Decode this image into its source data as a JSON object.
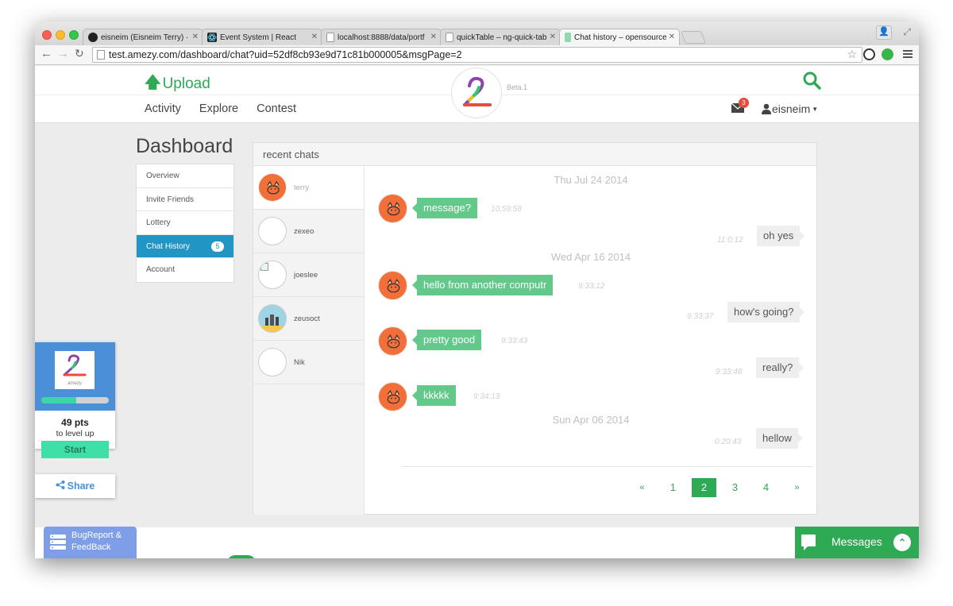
{
  "browser": {
    "tabs": [
      {
        "title": "eisneim (Eisneim Terry) · G",
        "icon": "github-icon"
      },
      {
        "title": "Event System | React",
        "icon": "react-icon"
      },
      {
        "title": "localhost:8888/data/portf",
        "icon": "page-icon"
      },
      {
        "title": "quickTable – ng-quick-tab",
        "icon": "page-icon"
      },
      {
        "title": "Chat history – opensource",
        "icon": "page-icon"
      }
    ],
    "url": "test.amezy.com/dashboard/chat?uid=52df8cb93e9d71c81b000005&msgPage=2"
  },
  "header": {
    "upload_label": "Upload",
    "beta_label": "Beta.1",
    "nav": [
      "Activity",
      "Explore",
      "Contest"
    ],
    "unread_count": "3",
    "username": "eisneim"
  },
  "dashboard": {
    "title": "Dashboard",
    "menu": [
      {
        "label": "Overview"
      },
      {
        "label": "Invite Friends"
      },
      {
        "label": "Lottery"
      },
      {
        "label": "Chat History",
        "badge": "5"
      },
      {
        "label": "Account"
      }
    ]
  },
  "chat": {
    "panel_title": "recent chats",
    "contacts": [
      {
        "name": "terry"
      },
      {
        "name": "zexeo"
      },
      {
        "name": "joeslee"
      },
      {
        "name": "zeusoct"
      },
      {
        "name": "Nik"
      }
    ],
    "dates": [
      "Thu Jul 24 2014",
      "Wed Apr 16 2014",
      "Sun Apr 06 2014"
    ],
    "messages": [
      {
        "text": "message?",
        "time": "10:59:58",
        "dir": "in"
      },
      {
        "text": "oh yes",
        "time": "11:0:12",
        "dir": "out"
      },
      {
        "text": "hello from another computr",
        "time": "9:33:12",
        "dir": "in"
      },
      {
        "text": "how's going?",
        "time": "9:33:37",
        "dir": "out"
      },
      {
        "text": "pretty good",
        "time": "9:33:43",
        "dir": "in"
      },
      {
        "text": "really?",
        "time": "9:33:48",
        "dir": "out"
      },
      {
        "text": "kkkkk",
        "time": "9:34:13",
        "dir": "in"
      },
      {
        "text": "hellow",
        "time": "0:20:43",
        "dir": "out"
      }
    ],
    "pagination": {
      "prev": "«",
      "pages": [
        "1",
        "2",
        "3",
        "4"
      ],
      "current": "2",
      "next": "»"
    }
  },
  "widget": {
    "logo_text": "amezy",
    "progress": 0.52,
    "points": "49 pts",
    "level_text": "to level up",
    "start_label": "Start",
    "share_label": "Share"
  },
  "footer": {
    "bug_label_1": "BugReport &",
    "bug_label_2": "FeedBack",
    "messages_label": "Messages"
  },
  "colors": {
    "brand_green": "#2eaa55",
    "bubble_green": "#62c98b",
    "active_blue": "#2196c4",
    "avatar_orange": "#f36f3a"
  }
}
